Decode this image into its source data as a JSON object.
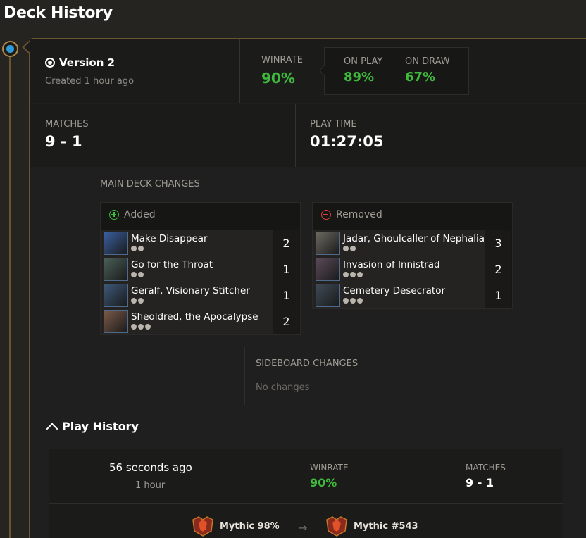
{
  "page_title": "Deck History",
  "version": {
    "title": "Version 2",
    "created": "Created 1 hour ago",
    "winrate_label": "WINRATE",
    "winrate": "90%",
    "on_play_label": "ON PLAY",
    "on_play": "89%",
    "on_draw_label": "ON DRAW",
    "on_draw": "67%",
    "matches_label": "MATCHES",
    "matches": "9 - 1",
    "play_time_label": "PLAY TIME",
    "play_time": "01:27:05"
  },
  "main_deck_changes": {
    "label": "MAIN DECK CHANGES",
    "added_label": "Added",
    "removed_label": "Removed",
    "added": [
      {
        "name": "Make Disappear",
        "count": "2",
        "pips": 2,
        "art_color": "#3a5fa0"
      },
      {
        "name": "Go for the Throat",
        "count": "1",
        "pips": 2,
        "art_color": "#4a5e58"
      },
      {
        "name": "Geralf, Visionary Stitcher",
        "count": "1",
        "pips": 2,
        "art_color": "#3d5878"
      },
      {
        "name": "Sheoldred, the Apocalypse",
        "count": "2",
        "pips": 3,
        "art_color": "#7a5a48"
      }
    ],
    "removed": [
      {
        "name": "Jadar, Ghoulcaller of Nephalia",
        "count": "3",
        "pips": 2,
        "art_color": "#6a6860"
      },
      {
        "name": "Invasion of Innistrad",
        "count": "2",
        "pips": 3,
        "art_color": "#5a4a58"
      },
      {
        "name": "Cemetery Desecrator",
        "count": "1",
        "pips": 3,
        "art_color": "#3e4a56"
      }
    ]
  },
  "sideboard_changes": {
    "label": "SIDEBOARD CHANGES",
    "empty": "No changes"
  },
  "play_history": {
    "title": "Play History",
    "entry": {
      "time": "56 seconds ago",
      "duration": "1 hour",
      "winrate_label": "WINRATE",
      "winrate": "90%",
      "matches_label": "MATCHES",
      "matches": "9 - 1",
      "rank_from": "Mythic 98%",
      "rank_to": "Mythic #543"
    }
  },
  "colors": {
    "accent_green": "#3fb93b",
    "removed_red": "#d8423a",
    "timeline_gold": "#6b5430",
    "timeline_dot": "#2e9ad8"
  }
}
